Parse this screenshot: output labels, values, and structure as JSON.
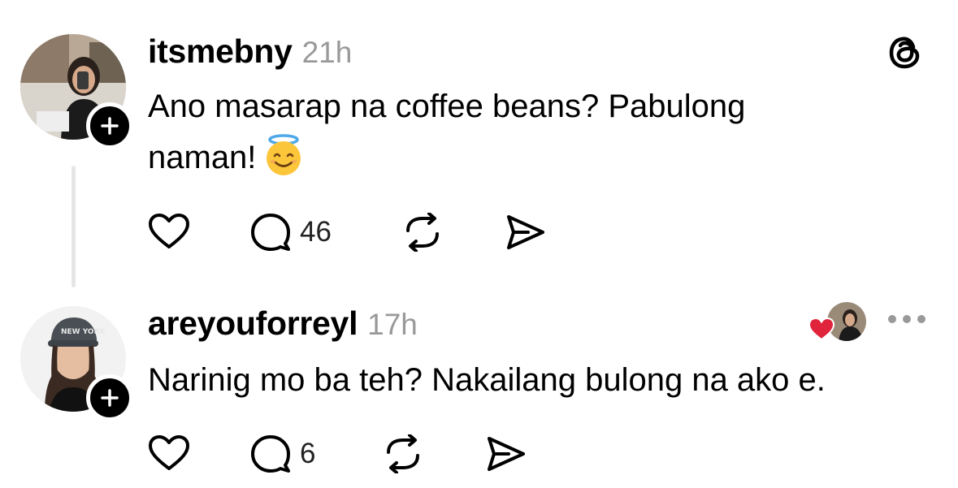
{
  "posts": [
    {
      "username": "itsmebny",
      "time": "21h",
      "text_line1": "Ano masarap na coffee beans? Pabulong",
      "text_line2": "naman!",
      "emoji": "smiling-face-with-halo",
      "replies": "46"
    },
    {
      "username": "areyouforreyl",
      "time": "17h",
      "text": "Narinig mo ba teh? Nakailang bulong na ako e.",
      "replies": "6",
      "cap_text": "NEW YORK"
    }
  ],
  "colors": {
    "text": "#000000",
    "muted": "#999999",
    "thread_line": "#e6e6e6",
    "like_heart": "#e0243b"
  }
}
